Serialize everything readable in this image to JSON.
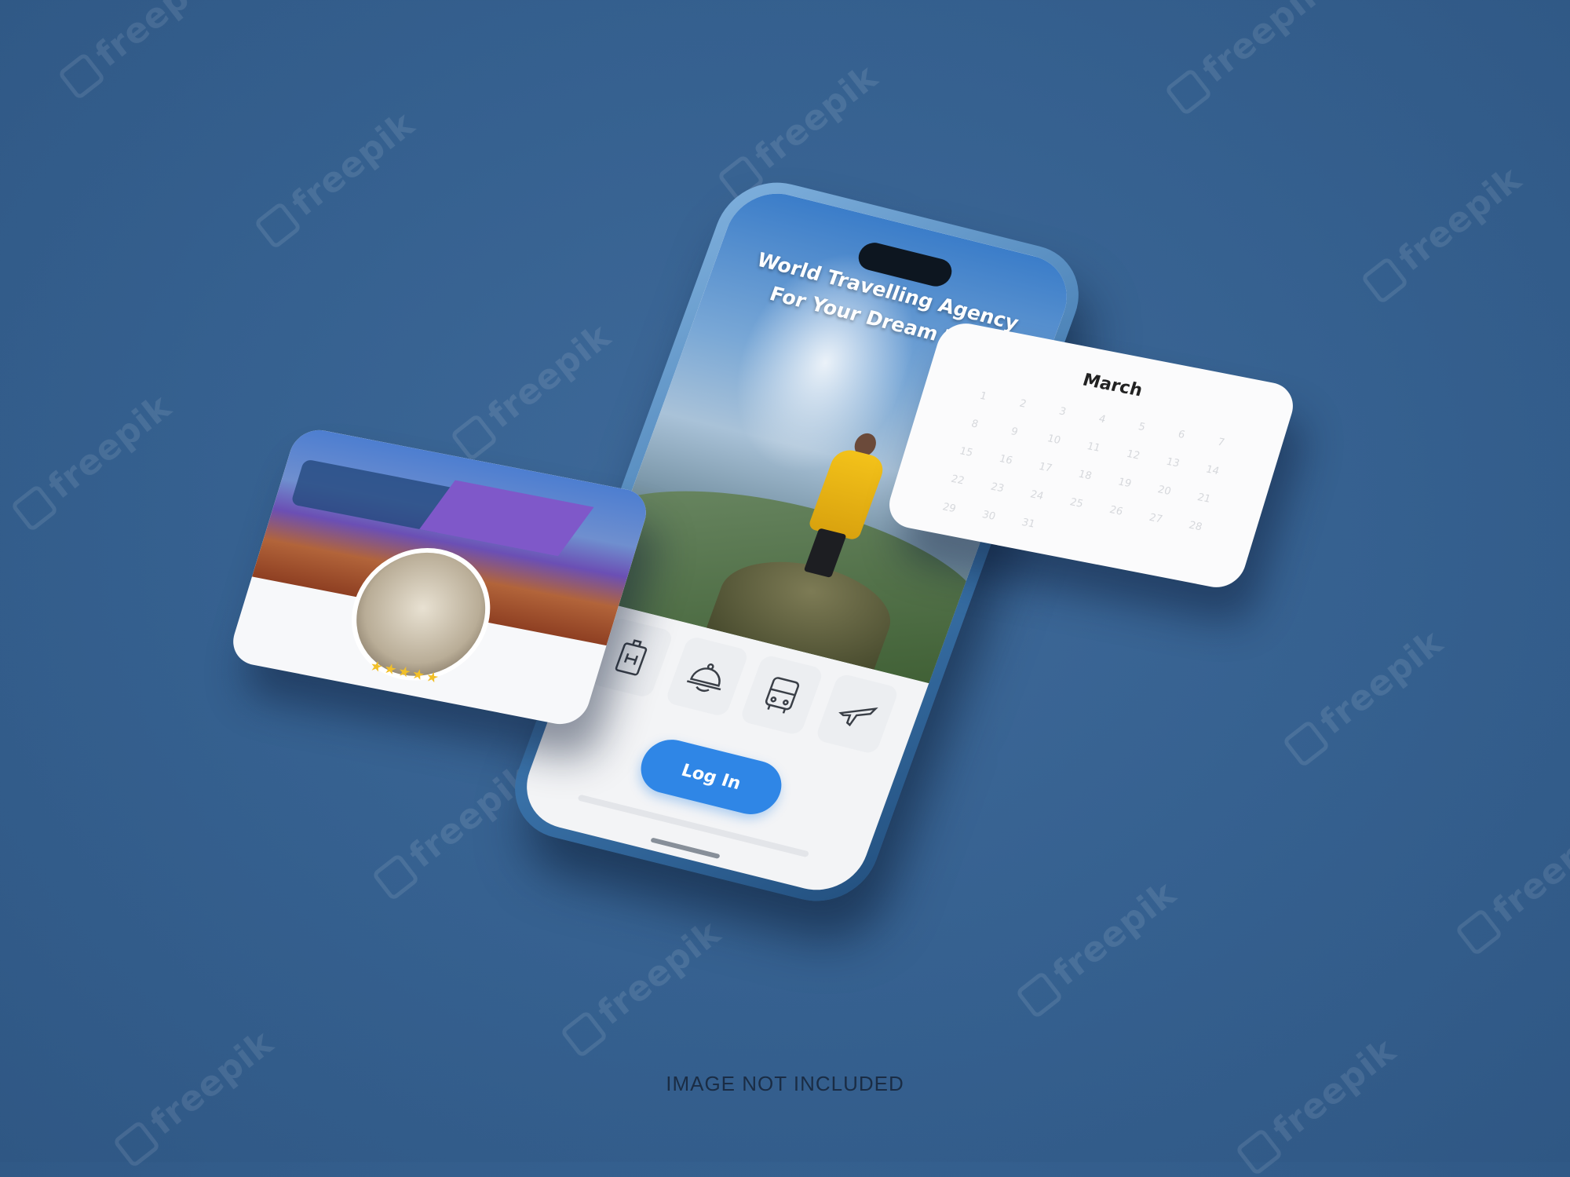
{
  "watermark": "freepik",
  "phone": {
    "headline_line1": "World Travelling Agency",
    "headline_line2": "For Your Dream Trip",
    "services": [
      {
        "icon": "hotel-icon"
      },
      {
        "icon": "cloche-icon"
      },
      {
        "icon": "bus-icon"
      },
      {
        "icon": "airplane-icon"
      }
    ],
    "login_label": "Log In"
  },
  "hotel_card": {
    "rating": "★★★★★",
    "rating_color": "#f2c029"
  },
  "calendar_card": {
    "month": "March",
    "days": [
      "1",
      "2",
      "3",
      "4",
      "5",
      "6",
      "7",
      "8",
      "9",
      "10",
      "11",
      "12",
      "13",
      "14",
      "15",
      "16",
      "17",
      "18",
      "19",
      "20",
      "21",
      "22",
      "23",
      "24",
      "25",
      "26",
      "27",
      "28",
      "29",
      "30",
      "31"
    ]
  },
  "caption": "IMAGE NOT INCLUDED",
  "colors": {
    "background": "#35608f",
    "accent": "#2f86e6",
    "coat": "#f3c21a"
  }
}
